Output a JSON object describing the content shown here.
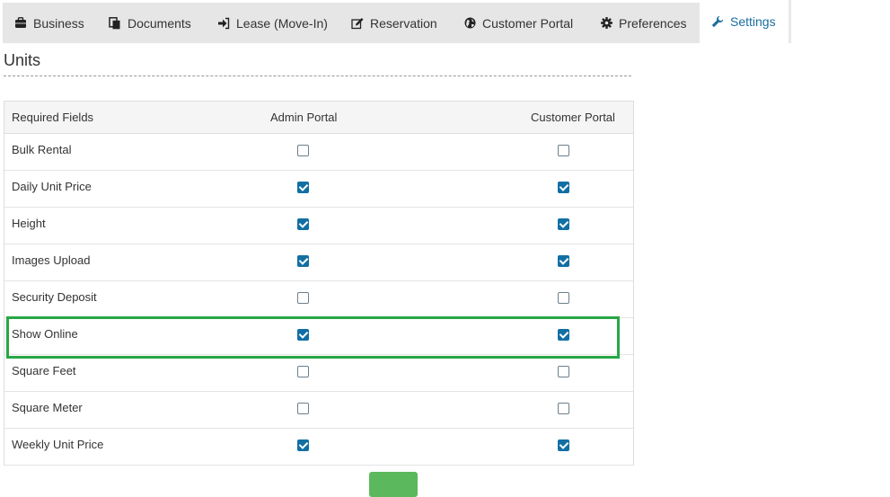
{
  "tabs": [
    {
      "label": "Business",
      "icon": "briefcase-icon"
    },
    {
      "label": "Documents",
      "icon": "documents-icon"
    },
    {
      "label": "Lease (Move-In)",
      "icon": "sign-in-icon"
    },
    {
      "label": "Reservation",
      "icon": "edit-icon"
    },
    {
      "label": "Customer Portal",
      "icon": "globe-icon"
    },
    {
      "label": "Preferences",
      "icon": "gear-icon"
    },
    {
      "label": "Settings",
      "icon": "wrench-icon",
      "active": true
    }
  ],
  "section": {
    "title": "Units"
  },
  "table": {
    "headers": {
      "field": "Required Fields",
      "admin": "Admin Portal",
      "customer": "Customer Portal"
    },
    "rows": [
      {
        "label": "Bulk Rental",
        "admin": false,
        "customer": false
      },
      {
        "label": "Daily Unit Price",
        "admin": true,
        "customer": true
      },
      {
        "label": "Height",
        "admin": true,
        "customer": true
      },
      {
        "label": "Images Upload",
        "admin": true,
        "customer": true
      },
      {
        "label": "Security Deposit",
        "admin": false,
        "customer": false
      },
      {
        "label": "Show Online",
        "admin": true,
        "customer": true,
        "highlighted": true
      },
      {
        "label": "Square Feet",
        "admin": false,
        "customer": false
      },
      {
        "label": "Square Meter",
        "admin": false,
        "customer": false
      },
      {
        "label": "Weekly Unit Price",
        "admin": true,
        "customer": true
      }
    ]
  },
  "colors": {
    "accent": "#126fa3",
    "active_tab_text": "#1a6e9f",
    "highlight": "#28a745",
    "save_button": "#5cb85c"
  }
}
